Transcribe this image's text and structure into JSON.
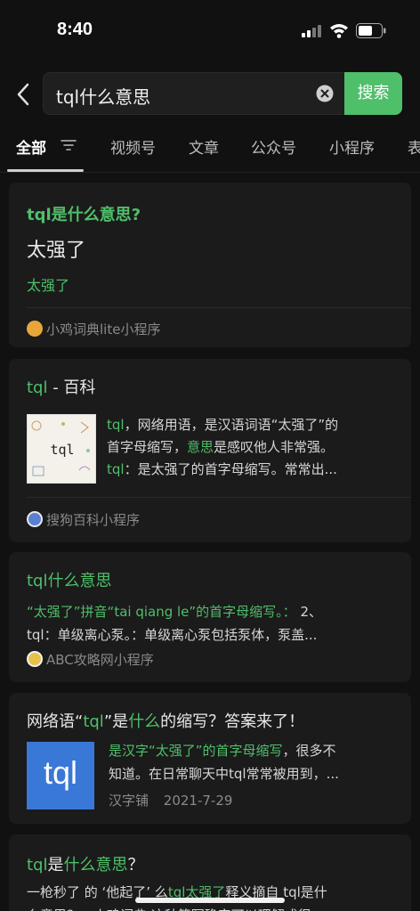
{
  "status_bar": {
    "time": "8:40"
  },
  "search": {
    "value": "tql什么意思",
    "button_label": "搜索"
  },
  "tabs": [
    {
      "label": "全部"
    },
    {
      "label": "视频号"
    },
    {
      "label": "文章"
    },
    {
      "label": "公众号"
    },
    {
      "label": "小程序"
    },
    {
      "label": "表"
    }
  ],
  "results": [
    {
      "title": "tql是什么意思?",
      "answer": "太强了",
      "answer_sub": "太强了",
      "source": "小鸡词典lite小程序"
    },
    {
      "title_a": "tql",
      "title_b": " - 百科",
      "thumb_text": "tql",
      "line1_a": "tql",
      "line1_b": "，网络用语，是汉语词语“太强了”的",
      "line2_a": "首字母缩写，",
      "line2_b": "意思",
      "line2_c": "是感叹他人非常强。",
      "line3_a": "tql",
      "line3_b": "：是太强了的首字母缩写。常常出...",
      "source": "搜狗百科小程序"
    },
    {
      "title": "tql什么意思",
      "line1": "“太强了”拼音“tai qiang le”的首字母缩写。：",
      "line1_tail": " 2、",
      "line2": "tql：单级离心泵。：单级离心泵包括泵体，泵盖...",
      "source": "ABC攻略网小程序"
    },
    {
      "title_a": "网络语“",
      "title_b": "tql",
      "title_c": "”是",
      "title_d": "什么",
      "title_e": "的缩写？答案来了！",
      "thumb_text": "tql",
      "line1_a": "是汉字“太强了”的首字母缩写",
      "line1_b": "，很多不",
      "line2": "知道。在日常聊天中tql常常被用到，...",
      "source": "汉字铺",
      "date": "2021-7-29"
    },
    {
      "title_a": "tql",
      "title_b": "是",
      "title_c": "什么意思",
      "title_d": "？",
      "line1_a": "一枪秒了 的 ‘他起了’ 么",
      "line1_b": "tql太强了",
      "line1_c": "释义摘自 tql是什",
      "line2": "么意思？ - 小鸡词典 这种简写确实可以理解成很"
    }
  ]
}
